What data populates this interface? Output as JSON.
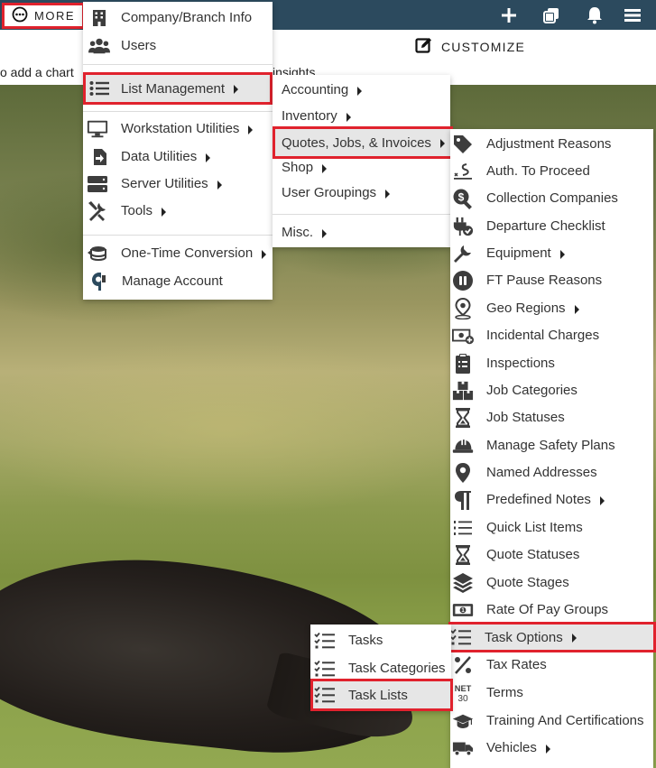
{
  "topbar": {
    "more_label": "MORE",
    "icons": [
      "plus-icon",
      "copy-icon",
      "bell-icon",
      "hamburger-icon"
    ]
  },
  "subbar": {
    "customize_label": "CUSTOMIZE",
    "hint_left": "o add a chart",
    "hint_right": "insights"
  },
  "menu_more": {
    "items": [
      {
        "label": "Company/Branch Info",
        "icon": "building-icon"
      },
      {
        "label": "Users",
        "icon": "users-icon"
      },
      {
        "label": "List Management",
        "icon": "list-icon",
        "submenu": true,
        "active": true
      },
      {
        "label": "Workstation Utilities",
        "icon": "monitor-icon",
        "submenu": true
      },
      {
        "label": "Data Utilities",
        "icon": "file-import-icon",
        "submenu": true
      },
      {
        "label": "Server Utilities",
        "icon": "server-icon",
        "submenu": true
      },
      {
        "label": "Tools",
        "icon": "tools-icon",
        "submenu": true
      },
      {
        "label": "One-Time Conversion",
        "icon": "database-convert-icon",
        "submenu": true
      },
      {
        "label": "Manage Account",
        "icon": "account-logo-icon"
      }
    ]
  },
  "menu_list_management": {
    "items": [
      {
        "label": "Accounting",
        "submenu": true
      },
      {
        "label": "Inventory",
        "submenu": true
      },
      {
        "label": "Quotes, Jobs, & Invoices",
        "submenu": true,
        "active": true
      },
      {
        "label": "Shop",
        "submenu": true
      },
      {
        "label": "User Groupings",
        "submenu": true
      },
      {
        "label": "Misc.",
        "submenu": true
      }
    ]
  },
  "menu_qji": {
    "items": [
      {
        "label": "Adjustment Reasons",
        "icon": "tag-icon"
      },
      {
        "label": "Auth. To Proceed",
        "icon": "signature-icon"
      },
      {
        "label": "Collection Companies",
        "icon": "search-dollar-icon"
      },
      {
        "label": "Departure Checklist",
        "icon": "plug-check-icon"
      },
      {
        "label": "Equipment",
        "icon": "wrench-icon",
        "submenu": true
      },
      {
        "label": "FT Pause Reasons",
        "icon": "pause-circle-icon"
      },
      {
        "label": "Geo Regions",
        "icon": "map-marker-icon",
        "submenu": true
      },
      {
        "label": "Incidental Charges",
        "icon": "money-plus-icon"
      },
      {
        "label": "Inspections",
        "icon": "clipboard-icon"
      },
      {
        "label": "Job Categories",
        "icon": "boxes-icon"
      },
      {
        "label": "Job Statuses",
        "icon": "hourglass-icon"
      },
      {
        "label": "Manage Safety Plans",
        "icon": "hard-hat-icon"
      },
      {
        "label": "Named Addresses",
        "icon": "location-pin-icon"
      },
      {
        "label": "Predefined Notes",
        "icon": "paragraph-icon",
        "submenu": true
      },
      {
        "label": "Quick List Items",
        "icon": "list-numbered-icon"
      },
      {
        "label": "Quote Statuses",
        "icon": "hourglass-icon"
      },
      {
        "label": "Quote Stages",
        "icon": "layers-icon"
      },
      {
        "label": "Rate Of Pay Groups",
        "icon": "cash-icon"
      },
      {
        "label": "Task Options",
        "icon": "task-list-icon",
        "submenu": true,
        "active": true
      },
      {
        "label": "Tax Rates",
        "icon": "percent-icon"
      },
      {
        "label": "Terms",
        "icon": "net30-icon",
        "icon_text": "NET\n30"
      },
      {
        "label": "Training And Certifications",
        "icon": "graduation-cap-icon"
      },
      {
        "label": "Vehicles",
        "icon": "truck-icon",
        "submenu": true
      }
    ]
  },
  "menu_task_options": {
    "items": [
      {
        "label": "Tasks",
        "icon": "task-list-icon"
      },
      {
        "label": "Task Categories",
        "icon": "task-list-icon"
      },
      {
        "label": "Task Lists",
        "icon": "task-list-icon",
        "active": true
      }
    ]
  }
}
